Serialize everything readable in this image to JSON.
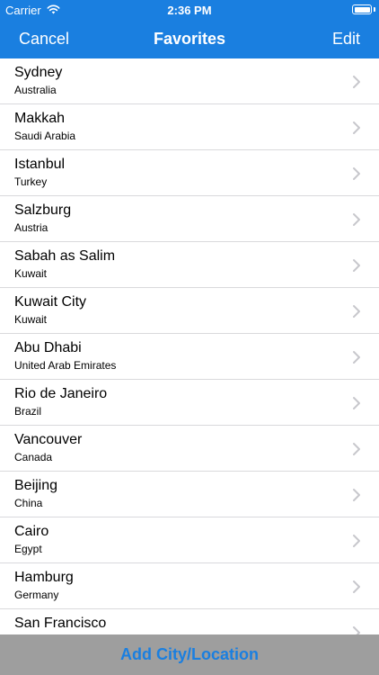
{
  "status_bar": {
    "carrier": "Carrier",
    "time": "2:36 PM",
    "battery_level": 1.0
  },
  "nav": {
    "left_label": "Cancel",
    "title": "Favorites",
    "right_label": "Edit"
  },
  "favorites": [
    {
      "city": "Sydney",
      "country": "Australia"
    },
    {
      "city": "Makkah",
      "country": "Saudi Arabia"
    },
    {
      "city": "Istanbul",
      "country": "Turkey"
    },
    {
      "city": "Salzburg",
      "country": "Austria"
    },
    {
      "city": "Sabah as Salim",
      "country": "Kuwait"
    },
    {
      "city": "Kuwait City",
      "country": "Kuwait"
    },
    {
      "city": "Abu Dhabi",
      "country": "United Arab Emirates"
    },
    {
      "city": "Rio de Janeiro",
      "country": "Brazil"
    },
    {
      "city": "Vancouver",
      "country": "Canada"
    },
    {
      "city": "Beijing",
      "country": "China"
    },
    {
      "city": "Cairo",
      "country": "Egypt"
    },
    {
      "city": "Hamburg",
      "country": "Germany"
    },
    {
      "city": "San Francisco",
      "country": ""
    }
  ],
  "bottom": {
    "add_label": "Add City/Location"
  },
  "colors": {
    "accent": "#1a7fe0",
    "bottom_bar": "#9e9e9e",
    "separator": "#d9d9dc",
    "chevron": "#c7c7cc"
  },
  "icons": {
    "wifi": "wifi-icon",
    "battery": "battery-icon",
    "row_disclosure": "chevron-right-icon"
  }
}
